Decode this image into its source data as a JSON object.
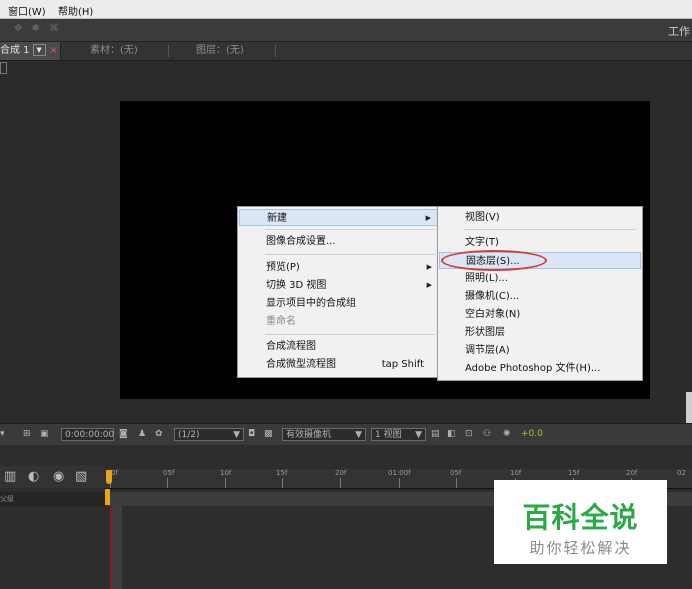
{
  "menubar": {
    "items": [
      "窗口(W)",
      "帮助(H)"
    ]
  },
  "toolbar": {
    "workspace": "工作"
  },
  "tabs": {
    "comp": "合成 1",
    "footage": "素材：(无)",
    "layer": "图层：(无)"
  },
  "context_menu": {
    "items": [
      {
        "label": "新建",
        "submenu": true
      },
      {
        "label": "图像合成设置..."
      },
      {
        "label": "预览(P)",
        "submenu": true
      },
      {
        "label": "切换 3D 视图",
        "submenu": true
      },
      {
        "label": "显示项目中的合成组"
      },
      {
        "label": "重命名",
        "disabled": true
      },
      {
        "label": "合成流程图"
      },
      {
        "label": "合成微型流程图",
        "shortcut": "tap Shift"
      }
    ]
  },
  "submenu": {
    "items": [
      "视图(V)",
      "文字(T)",
      "固态层(S)...",
      "照明(L)...",
      "摄像机(C)...",
      "空白对象(N)",
      "形状图层",
      "调节层(A)",
      "Adobe Photoshop 文件(H)..."
    ],
    "highlighted": "固态层(S)..."
  },
  "controls": {
    "timecode": "0:00:00:00",
    "resolution": "(1/2)",
    "camera": "有效摄像机",
    "views": "1 视图",
    "exposure": "+0.0"
  },
  "timeline": {
    "ruler_labels": [
      "0f",
      "05f",
      "10f",
      "15f",
      "20f",
      "01:00f",
      "05f",
      "10f",
      "15f",
      "20f",
      "02"
    ],
    "row_label": "父级"
  },
  "watermark": {
    "title": "百科全说",
    "subtitle": "助你轻松解决"
  },
  "colors": {
    "highlight_circle": "#d43a3a",
    "playhead": "#e6a31c",
    "watermark_green": "#2aa946"
  }
}
